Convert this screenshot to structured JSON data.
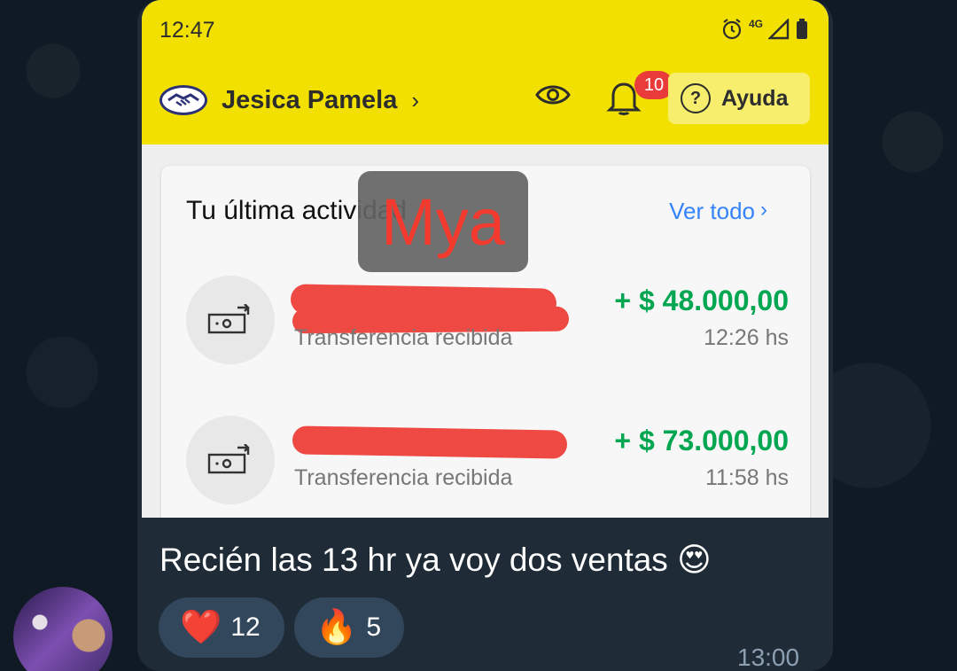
{
  "status_bar": {
    "time": "12:47",
    "network": "4G"
  },
  "header": {
    "user_name": "Jesica Pamela",
    "notifications_count": "10",
    "help_label": "Ayuda"
  },
  "activity": {
    "title": "Tu última actividad",
    "see_all": "Ver todo",
    "transactions": [
      {
        "description": "Transferencia recibida",
        "amount": "+ $ 48.000,00",
        "time": "12:26 hs"
      },
      {
        "description": "Transferencia recibida",
        "amount": "+ $ 73.000,00",
        "time": "11:58 hs"
      }
    ]
  },
  "watermark": "Mya",
  "message": {
    "text": "Recién las 13 hr ya voy dos ventas 😍",
    "time": "13:00"
  },
  "reactions": [
    {
      "emoji": "❤️",
      "count": "12"
    },
    {
      "emoji": "🔥",
      "count": "5"
    }
  ],
  "colors": {
    "brand_yellow": "#f2e100",
    "link_blue": "#3483fa",
    "income_green": "#00a650",
    "badge_red": "#ea3b3b"
  }
}
